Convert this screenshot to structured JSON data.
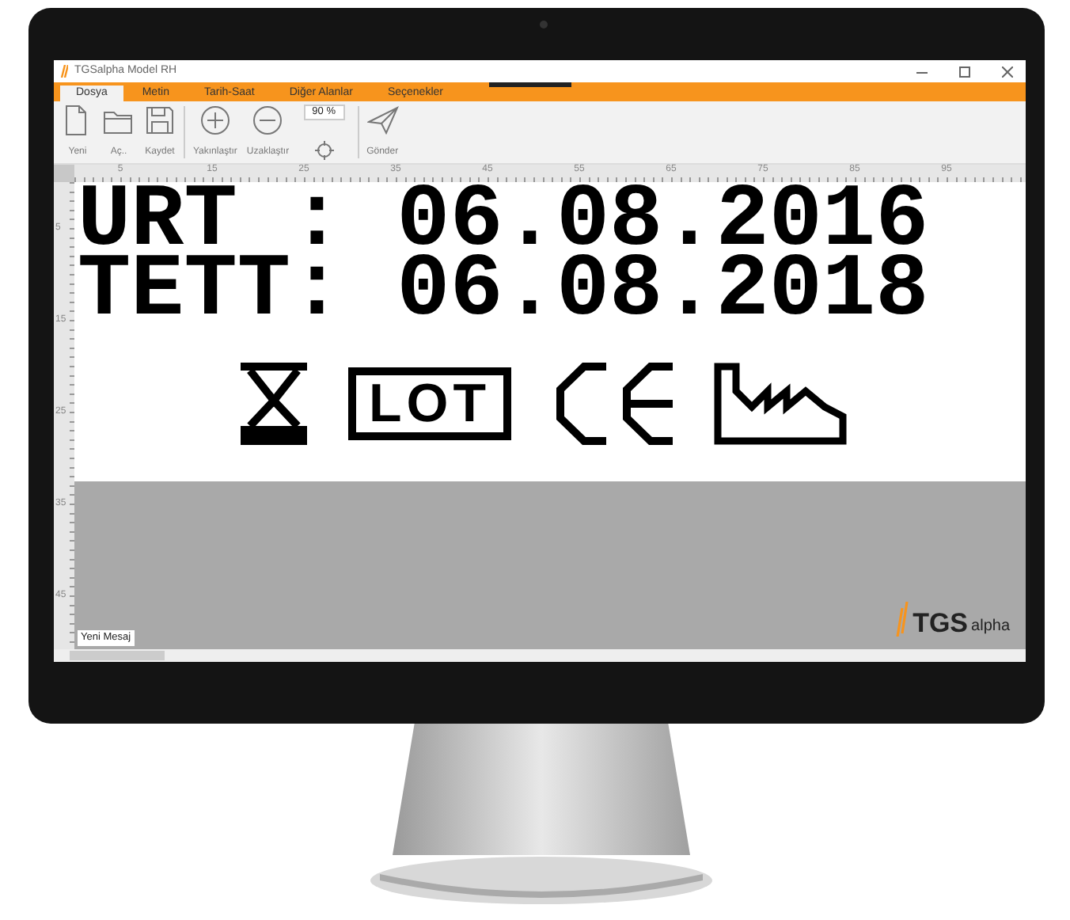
{
  "window": {
    "title": "TGSalpha Model RH"
  },
  "tabs": [
    {
      "label": "Dosya",
      "selected": true
    },
    {
      "label": "Metin",
      "selected": false
    },
    {
      "label": "Tarih-Saat",
      "selected": false
    },
    {
      "label": "Diğer Alanlar",
      "selected": false
    },
    {
      "label": "Seçenekler",
      "selected": false
    }
  ],
  "toolbar": [
    {
      "kind": "button",
      "label": "Yeni"
    },
    {
      "kind": "button",
      "label": "Aç.."
    },
    {
      "kind": "button",
      "label": "Kaydet"
    },
    {
      "kind": "separator"
    },
    {
      "kind": "button",
      "label": "Yakınlaştır"
    },
    {
      "kind": "button",
      "label": "Uzaklaştır"
    },
    {
      "kind": "zoom",
      "value": "90 %"
    },
    {
      "kind": "separator"
    },
    {
      "kind": "button",
      "label": "Gönder"
    }
  ],
  "rulers": {
    "horizontal": [
      "5",
      "15",
      "25",
      "35",
      "45",
      "55",
      "65",
      "75",
      "85",
      "95"
    ],
    "vertical": [
      "5",
      "15",
      "25",
      "35",
      "45"
    ]
  },
  "label": {
    "lines": [
      "URT : 06.08.2016",
      "TETT: 06.08.2018"
    ],
    "symbols": [
      {
        "kind": "hourglass"
      },
      {
        "kind": "lot",
        "text": "LOT"
      },
      {
        "kind": "ce"
      },
      {
        "kind": "factory"
      }
    ]
  },
  "message_tag": "Yeni Mesaj",
  "logo": {
    "brand": "TGS",
    "sub": "alpha"
  }
}
